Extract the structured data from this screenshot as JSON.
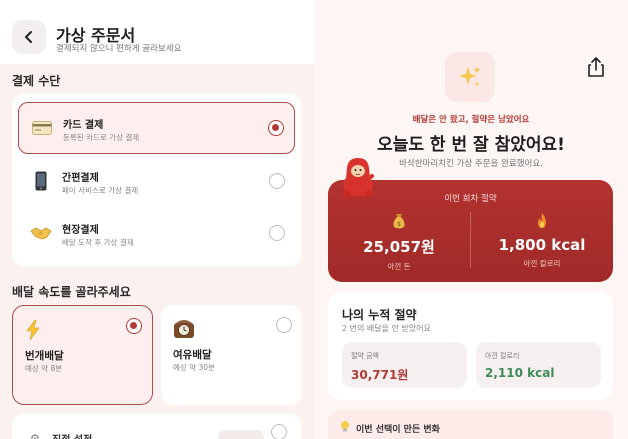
{
  "header": {
    "title": "가상 주문서",
    "subtitle": "결제되지 않으니 편하게 골라보세요"
  },
  "payment": {
    "section_title": "결제 수단",
    "items": [
      {
        "name": "카드 결제",
        "desc": "등록된 카드로 가상 결제",
        "icon": "credit-card-icon",
        "selected": true
      },
      {
        "name": "간편결제",
        "desc": "페이 서비스로 가상 결제",
        "icon": "mobile-phone-icon",
        "selected": false
      },
      {
        "name": "현장결제",
        "desc": "배달 도착 후 가상 결제",
        "icon": "handshake-icon",
        "selected": false
      }
    ]
  },
  "speed": {
    "section_title": "배달 속도를 골라주세요",
    "options": [
      {
        "name": "번개배달",
        "time": "예상 약 8분",
        "icon": "lightning-icon",
        "selected": true
      },
      {
        "name": "여유배달",
        "time": "예상 약 30분",
        "icon": "clock-icon",
        "selected": false
      }
    ],
    "direct": {
      "name": "직접 설정",
      "icon": "gear-icon"
    }
  },
  "result": {
    "top_note": "배달은 안 왔고, 절약은 남았어요",
    "headline": "오늘도 한 번 잘 참았어요!",
    "sub": "바삭한마리치킨 가상 주문을 완료했어요.",
    "icons": {
      "sparkle": "sparkles-icon",
      "share": "share-icon",
      "mascot": "mascot-character"
    }
  },
  "this_round": {
    "title": "이번 회차 절약",
    "money_value": "25,057원",
    "money_label": "아낀 돈",
    "kcal_value": "1,800 kcal",
    "kcal_label": "아낀 칼로리",
    "money_icon": "money-bag-icon",
    "kcal_icon": "fire-icon"
  },
  "cumulative": {
    "title": "나의 누적 절약",
    "sub": "2 번의 배달을 안 받았어요",
    "money_label": "절약 금액",
    "money_value": "30,771원",
    "kcal_label": "아낀 칼로리",
    "kcal_value": "2,110 kcal"
  },
  "change": {
    "icon": "lightbulb-icon",
    "text": "이번 선택이 만든 변화"
  },
  "colors": {
    "accent": "#b43a35",
    "card_red": "#a92e2b",
    "money_text": "#b43a35",
    "kcal_text": "#3f8a58",
    "background": "#fbf1ef"
  }
}
